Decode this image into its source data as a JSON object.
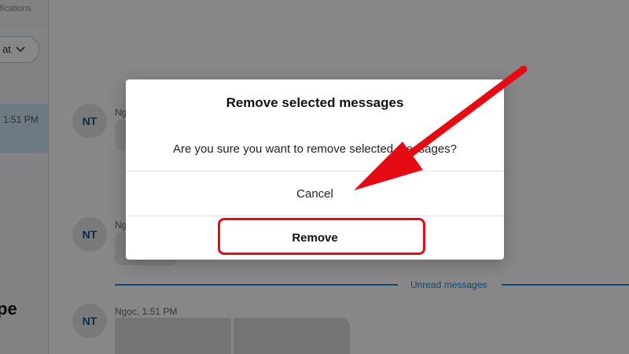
{
  "sidebar": {
    "notifications_label": "Notifications",
    "notifications_partial": "tifications",
    "filter_label": "Chat",
    "filter_partial": "at",
    "active_chat_time": "1:51 PM",
    "partial_title": "pe"
  },
  "messages": [
    {
      "avatar": "NT",
      "sender_partial": "Ng"
    },
    {
      "avatar": "NT",
      "sender_partial": "Ng"
    },
    {
      "avatar": "NT",
      "sender_meta": "Ngọc, 1:51 PM"
    }
  ],
  "unread_divider": {
    "label": "Unread messages"
  },
  "dialog": {
    "title": "Remove selected messages",
    "message": "Are you sure you want to remove selected messages?",
    "cancel_label": "Cancel",
    "remove_label": "Remove"
  },
  "colors": {
    "accent": "#1c8ad8",
    "annotation": "#e60b12",
    "avatar_text": "#1f4e8c"
  },
  "icons": {
    "filter_chevron": "chevron-down-icon",
    "annotation_arrow": "arrow-icon"
  }
}
